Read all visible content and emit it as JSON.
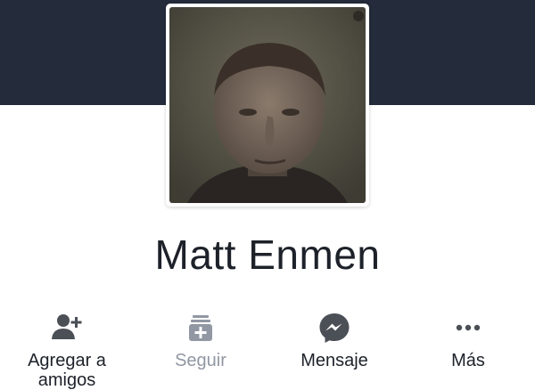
{
  "profile": {
    "name": "Matt Enmen"
  },
  "actions": [
    {
      "id": "add-friend",
      "label_line1": "Agregar a",
      "label_line2": "amigos",
      "icon": "add-friend-icon",
      "enabled": true
    },
    {
      "id": "follow",
      "label": "Seguir",
      "icon": "follow-icon",
      "enabled": false
    },
    {
      "id": "message",
      "label": "Mensaje",
      "icon": "messenger-icon",
      "enabled": true
    },
    {
      "id": "more",
      "label": "Más",
      "icon": "more-dots-icon",
      "enabled": true
    }
  ],
  "colors": {
    "cover": "#242b3a",
    "icon_active": "#4b4f56",
    "icon_disabled": "#9197a3",
    "text": "#1d2129"
  }
}
